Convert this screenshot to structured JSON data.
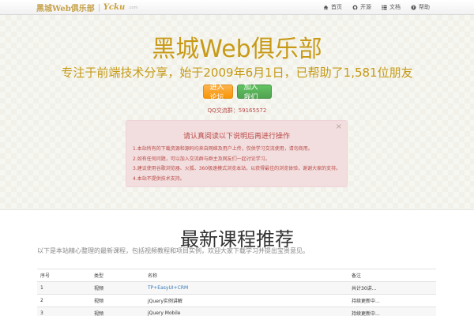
{
  "navbar": {
    "brand_text": "黑城Web俱乐部",
    "brand_logo": "Ycku",
    "brand_domain": ".com",
    "items": [
      {
        "icon": "home-icon",
        "label": "首页"
      },
      {
        "icon": "github-icon",
        "label": "开源"
      },
      {
        "icon": "list-icon",
        "label": "文档"
      },
      {
        "icon": "help-icon",
        "label": "帮助"
      }
    ]
  },
  "hero": {
    "title": "黑城Web俱乐部",
    "subtitle": "专注于前端技术分享，始于2009年6月1日，已帮助了1,581位朋友",
    "btn_primary": "进入论坛",
    "btn_secondary": "加入我们",
    "qq": "QQ交流群：59165572",
    "alert": {
      "title": "请认真阅读以下说明后再进行操作",
      "items": [
        "1.本站所有的下载资源和源码均来自网络及用户上传，仅供学习交流使用，请勿商用。",
        "2.如有任何问题，可以加入交流群与群主及网友们一起讨论学习。",
        "3.建议使用谷歌浏览器、火狐、360极速模式浏览本站，以获得最佳的浏览体验，谢谢大家的支持。",
        "4.本站不提供技术支持。"
      ]
    }
  },
  "section": {
    "title": "最新课程推荐",
    "desc": "以下是本站精心整理的最新课程，包括视频教程和项目实例，欢迎大家下载学习并提出宝贵意见。",
    "table": {
      "headers": [
        "序号",
        "类型",
        "名称",
        "备注"
      ],
      "rows": [
        [
          "1",
          "视频",
          "TP+EasyUI+CRM",
          "共计30讲..."
        ],
        [
          "2",
          "视频",
          "jQuery实例讲解",
          "持续更新中..."
        ],
        [
          "3",
          "视频",
          "jQuery Mobile",
          "持续更新中..."
        ]
      ]
    }
  },
  "colors": {
    "accent": "#c89a17",
    "alert_bg": "#f2dede",
    "alert_text": "#b94a48",
    "btn_orange": "#f89406",
    "btn_green": "#51a351",
    "link": "#3478b7"
  }
}
